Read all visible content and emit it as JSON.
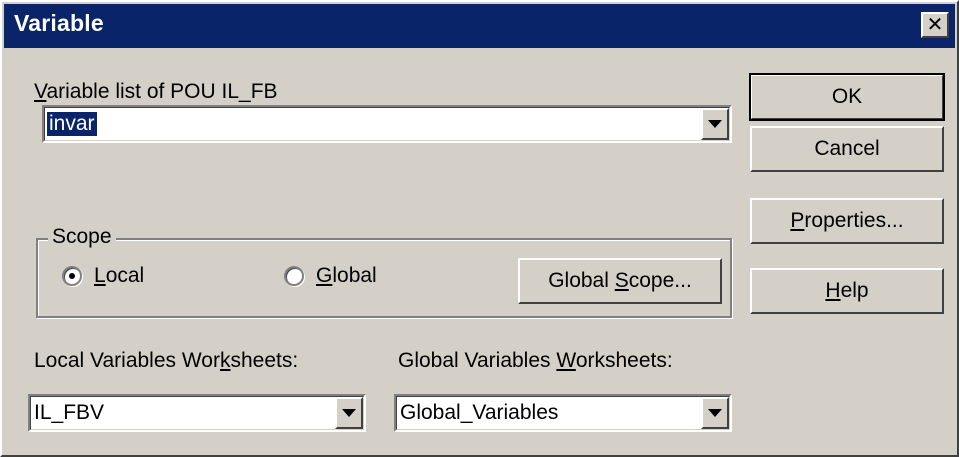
{
  "window": {
    "title": "Variable",
    "close_glyph": "✕"
  },
  "variable_list": {
    "label": "Variable list of POU IL_FB",
    "label_access_key": "V",
    "label_rest": "ariable list of POU IL_FB",
    "value": "invar"
  },
  "buttons": {
    "ok": "OK",
    "cancel": "Cancel",
    "properties_pre": "",
    "properties_key": "P",
    "properties_post": "roperties...",
    "help_pre": "",
    "help_key": "H",
    "help_post": "elp"
  },
  "scope": {
    "title": "Scope",
    "local_pre": "",
    "local_key": "L",
    "local_post": "ocal",
    "local_selected": true,
    "global_pre": "",
    "global_key": "G",
    "global_post": "lobal",
    "global_selected": false,
    "global_scope_pre": "Global ",
    "global_scope_key": "S",
    "global_scope_post": "cope..."
  },
  "local_worksheets": {
    "label_pre": "Local Variables Wor",
    "label_key": "k",
    "label_post": "sheets:",
    "value": "IL_FBV"
  },
  "global_worksheets": {
    "label_pre": "Global Variables ",
    "label_key": "W",
    "label_post": "orksheets:",
    "value": "Global_Variables"
  },
  "icons": {
    "close": "close-icon",
    "dropdown": "chevron-down-icon"
  }
}
